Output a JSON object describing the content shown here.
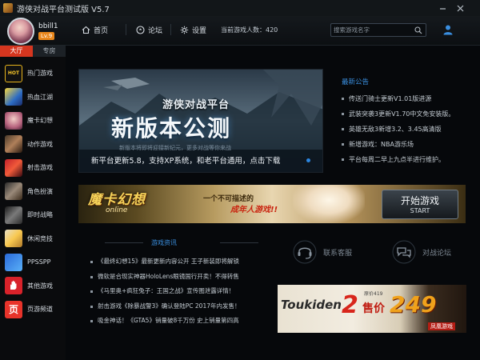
{
  "window": {
    "title": "游侠对战平台测试版 V5.7"
  },
  "user": {
    "name": "bbill1",
    "level": "Lv.9"
  },
  "nav": {
    "home": "首页",
    "forum": "论坛",
    "settings": "设置",
    "online": "当前游戏人数：420"
  },
  "search": {
    "placeholder": "搜索游戏名字"
  },
  "sidebar": {
    "tabs": [
      "大厅",
      "专房"
    ],
    "active_tab": "大厅",
    "items": [
      {
        "label": "热门游戏",
        "thumb": "HOT"
      },
      {
        "label": "热血江湖",
        "thumb": ""
      },
      {
        "label": "魔卡幻想",
        "thumb": ""
      },
      {
        "label": "动作游戏",
        "thumb": ""
      },
      {
        "label": "射击游戏",
        "thumb": ""
      },
      {
        "label": "角色扮演",
        "thumb": ""
      },
      {
        "label": "即时战略",
        "thumb": ""
      },
      {
        "label": "休闲竞技",
        "thumb": ""
      },
      {
        "label": "PPSSPP",
        "thumb": ""
      },
      {
        "label": "其他游戏",
        "thumb": ""
      },
      {
        "label": "页游频道",
        "thumb": "页"
      }
    ]
  },
  "banner": {
    "line1": "游侠对战平台",
    "line2": "新版本公测",
    "line3": "新版本将即将迎接新纪元，更多对战等你来战",
    "caption": "新平台更新5.8，支持XP系统，和老平台通用，点击下载"
  },
  "news": {
    "title": "最新公告",
    "items": [
      "传送门骑士更新V1.01版进源",
      "武装突袭3更新V1.70中文免安装版。",
      "英雄无敌3新增3.2、3.45高清版",
      "新增游戏：NBA游乐场",
      "平台每周二早上九点半进行维护。"
    ]
  },
  "ad_banner": {
    "logo": "魔卡幻想",
    "sub": "online",
    "line1": "一个不可描述的",
    "line2": "成年人游戏!!",
    "start_label": "开始游戏",
    "start_sub": "START"
  },
  "zixun": {
    "title": "游戏资讯",
    "items": [
      "《最终幻想15》最新更新内容公开 王子新装即将解锁",
      "微软是合现实神器HoloLens眼镜国行开卖！不得转售",
      "《马里奥+疯狂兔子：王国之战》宣传图泄露详情！",
      "射击游戏《除暴战警3》确认登陆PC 2017年内发售！",
      "吸金神话！《GTA5》销量破8千万份 史上销量第四高"
    ]
  },
  "services": {
    "support": "联系客服",
    "forum": "对战论坛"
  },
  "ad2": {
    "brand": "Toukiden",
    "numeral": "2",
    "original": "原价419",
    "sale": "售价",
    "price": "249",
    "publisher": "凤凰游戏"
  },
  "colors": {
    "accent_blue": "#3a8fe0",
    "tab_red": "#d5361f",
    "level_orange": "#e9871b"
  }
}
